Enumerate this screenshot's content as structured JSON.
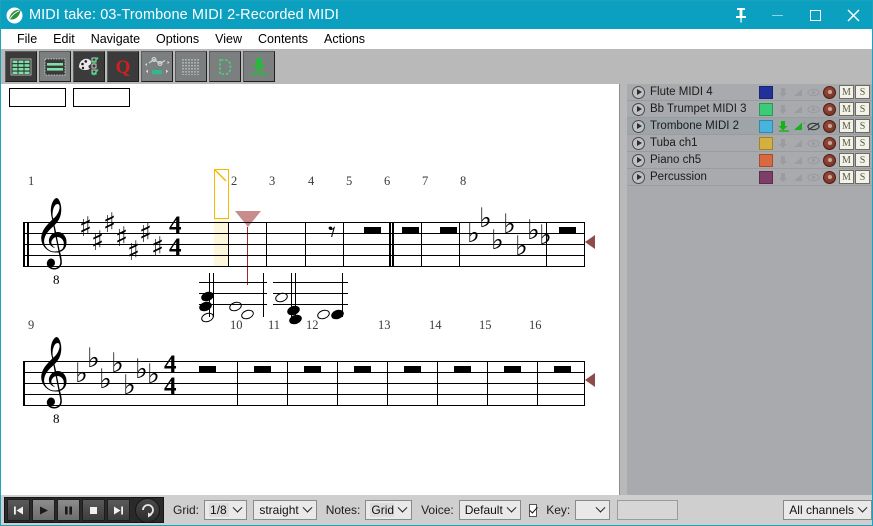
{
  "window": {
    "title": "MIDI take: 03-Trombone MIDI 2-Recorded MIDI",
    "logo_icon": "app-leaf-icon",
    "pin_icon": "pin-icon",
    "minimize_icon": "minimize-icon",
    "maximize_icon": "maximize-icon",
    "close_icon": "close-icon",
    "accent_color": "#0b9fc0"
  },
  "menu": {
    "items": [
      {
        "label": "File"
      },
      {
        "label": "Edit"
      },
      {
        "label": "Navigate"
      },
      {
        "label": "Options"
      },
      {
        "label": "View"
      },
      {
        "label": "Contents"
      },
      {
        "label": "Actions"
      }
    ]
  },
  "toolbar": {
    "buttons": [
      {
        "name": "grid-view-button",
        "icon": "grid-table-icon"
      },
      {
        "name": "list-view-button",
        "icon": "horizontal-bars-icon"
      },
      {
        "name": "palette-button",
        "icon": "palette-checklist-icon"
      },
      {
        "name": "quantize-button",
        "icon": "letter-q-icon"
      },
      {
        "name": "velocity-curve-button",
        "icon": "node-curve-icon"
      },
      {
        "name": "grid-lines-button",
        "icon": "vertical-grid-icon"
      },
      {
        "name": "loop-region-button",
        "icon": "dashed-loop-icon"
      },
      {
        "name": "import-button",
        "icon": "down-arrow-tray-icon"
      }
    ]
  },
  "fields": {
    "box1_value": "",
    "box2_value": ""
  },
  "score": {
    "systems": [
      {
        "name": "system-1",
        "clef": "treble-8vb",
        "key_signature": "7 sharps",
        "key_accidental": "sharp",
        "accidental_count": 7,
        "time_signature_top": "4",
        "time_signature_bottom": "4",
        "measure_numbers": [
          "1",
          "2",
          "3",
          "4",
          "5",
          "6",
          "7",
          "8"
        ],
        "end_marker": "playback-end-marker"
      },
      {
        "name": "system-2",
        "clef": "treble-8vb",
        "key_signature": "7 flats",
        "key_accidental": "flat",
        "accidental_count": 7,
        "time_signature_top": "4",
        "time_signature_bottom": "4",
        "measure_numbers": [
          "9",
          "10",
          "11",
          "12",
          "13",
          "14",
          "15",
          "16"
        ],
        "end_marker": "playback-end-marker"
      }
    ],
    "playhead": {
      "name": "playback-cursor",
      "highlight_color": "#fdf8dc",
      "flag_color": "#f5b800",
      "cursor_color": "#9e2a2a"
    }
  },
  "tracks": {
    "rows": [
      {
        "name": "Flute MIDI 4",
        "color": "#22309a",
        "selected": false,
        "mute": "M",
        "solo": "S"
      },
      {
        "name": "Bb Trumpet MIDI 3",
        "color": "#3ccb77",
        "selected": false,
        "mute": "M",
        "solo": "S"
      },
      {
        "name": "Trombone MIDI 2",
        "color": "#48b4dd",
        "selected": true,
        "mute": "M",
        "solo": "S"
      },
      {
        "name": "Tuba ch1",
        "color": "#d4b03e",
        "selected": false,
        "mute": "M",
        "solo": "S"
      },
      {
        "name": "Piano ch5",
        "color": "#d9693f",
        "selected": false,
        "mute": "M",
        "solo": "S"
      },
      {
        "name": "Percussion",
        "color": "#7e3e67",
        "selected": false,
        "mute": "M",
        "solo": "S"
      }
    ],
    "icons": {
      "play": "play-icon",
      "input": "midi-input-icon",
      "volume": "volume-ramp-icon",
      "monitor": "eye-monitor-icon",
      "record": "record-arm-icon"
    }
  },
  "bottom": {
    "transport": {
      "skip_back": "skip-to-start-icon",
      "play": "play-icon",
      "pause": "pause-icon",
      "stop": "stop-icon",
      "skip_forward": "skip-to-end-icon",
      "loop": "loop-icon"
    },
    "grid_label": "Grid:",
    "grid_value": "1/8",
    "swing_value": "straight",
    "notes_label": "Notes:",
    "notes_value": "Grid",
    "voice_label": "Voice:",
    "voice_value": "Default",
    "key_checkbox_checked": true,
    "key_label": "Key:",
    "key_value": "",
    "text_field_value": "",
    "channels_value": "All channels"
  }
}
